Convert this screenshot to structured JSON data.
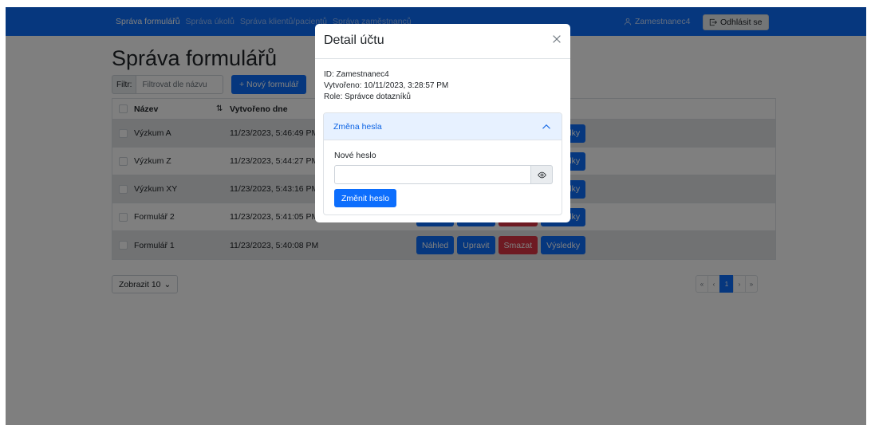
{
  "navbar": {
    "links": [
      "Správa formulářů",
      "Správa úkolů",
      "Správa klientů/pacientů",
      "Správa zaměstnanců"
    ],
    "user_name": "Zamestnanec4",
    "logout_label": "Odhlásit se"
  },
  "page": {
    "title": "Správa formulářů",
    "filter_label": "Filtr:",
    "filter_placeholder": "Filtrovat dle názvu",
    "new_form_label": "+ Nový formulář"
  },
  "table": {
    "headers": {
      "name": "Název",
      "created": "Vytvořeno dne"
    },
    "rows": [
      {
        "name": "Výzkum A",
        "created": "11/23/2023, 5:46:49 PM"
      },
      {
        "name": "Výzkum Z",
        "created": "11/23/2023, 5:44:27 PM"
      },
      {
        "name": "Výzkum XY",
        "created": "11/23/2023, 5:43:16 PM"
      },
      {
        "name": "Formulář 2",
        "created": "11/23/2023, 5:41:05 PM"
      },
      {
        "name": "Formulář 1",
        "created": "11/23/2023, 5:40:08 PM"
      }
    ],
    "actions": {
      "preview": "Náhled",
      "edit": "Upravit",
      "delete": "Smazat",
      "results": "Výsledky"
    }
  },
  "footer": {
    "page_size_label": "Zobrazit 10",
    "pagination": [
      "«",
      "‹",
      "1",
      "›",
      "»"
    ],
    "current_page": "1"
  },
  "modal": {
    "title": "Detail účtu",
    "id_line": "ID: Zamestnanec4",
    "created_line": "Vytvořeno: 10/11/2023, 3:28:57 PM",
    "role_line": "Role: Správce dotazníků",
    "accordion_title": "Změna hesla",
    "new_password_label": "Nové heslo",
    "change_button": "Změnit heslo"
  },
  "colors": {
    "primary": "#0d6efd",
    "danger": "#dc3545",
    "accordion_active_bg": "#e7f1ff"
  }
}
